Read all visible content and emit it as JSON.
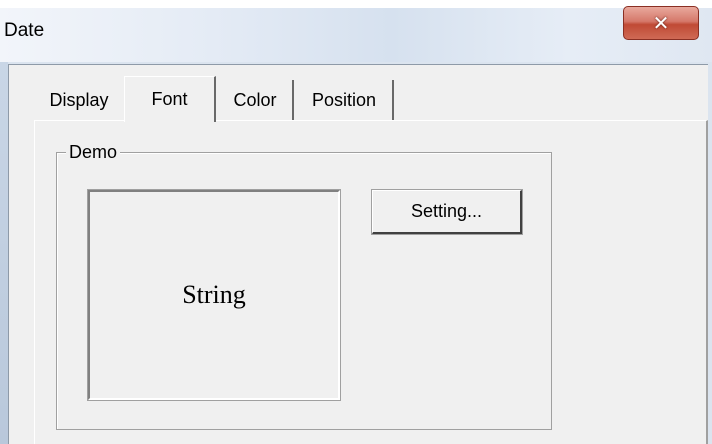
{
  "window": {
    "title": "Date",
    "close_icon": "close-icon"
  },
  "tabs": [
    {
      "label": "Display",
      "selected": false
    },
    {
      "label": "Font",
      "selected": true
    },
    {
      "label": "Color",
      "selected": false
    },
    {
      "label": "Position",
      "selected": false
    }
  ],
  "demo_group": {
    "legend": "Demo",
    "sample_text": "String",
    "setting_label": "Setting..."
  },
  "colors": {
    "close_button": "#c9503c",
    "panel_background": "#f0f0f0"
  }
}
